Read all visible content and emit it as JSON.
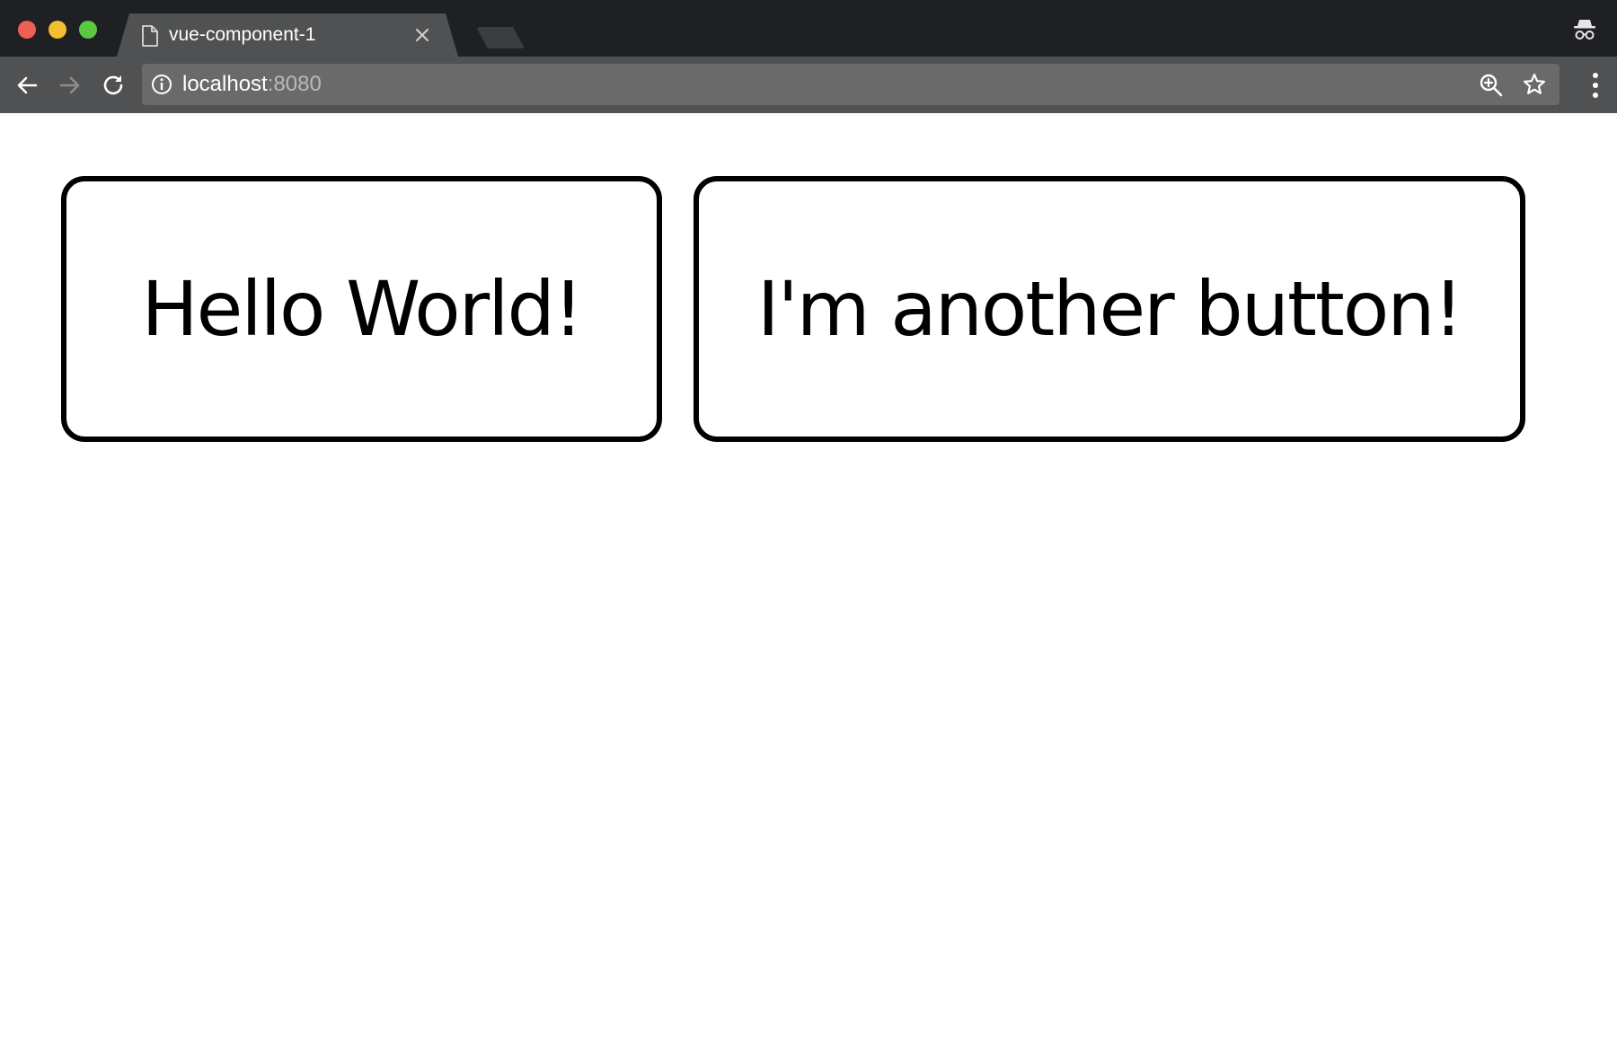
{
  "browser": {
    "tab": {
      "title": "vue-component-1"
    },
    "address_bar": {
      "host": "localhost",
      "port": ":8080"
    },
    "icons": {
      "back": "arrow-left",
      "forward": "arrow-right",
      "reload": "reload",
      "site_info": "info-circle",
      "zoom": "zoom-in",
      "bookmark": "star",
      "menu": "vertical-ellipsis",
      "incognito": "incognito",
      "tab_page": "document",
      "tab_close": "close"
    },
    "colors": {
      "traffic_close": "#ed5f57",
      "traffic_minimize": "#f5bd30",
      "traffic_maximize": "#5ac941",
      "tabbar_bg": "#1f2023",
      "toolbar_bg": "#505153",
      "omnibox_bg": "#6a6a6b"
    }
  },
  "page": {
    "buttons": [
      {
        "label": "Hello World!"
      },
      {
        "label": "I'm another button!"
      }
    ]
  }
}
